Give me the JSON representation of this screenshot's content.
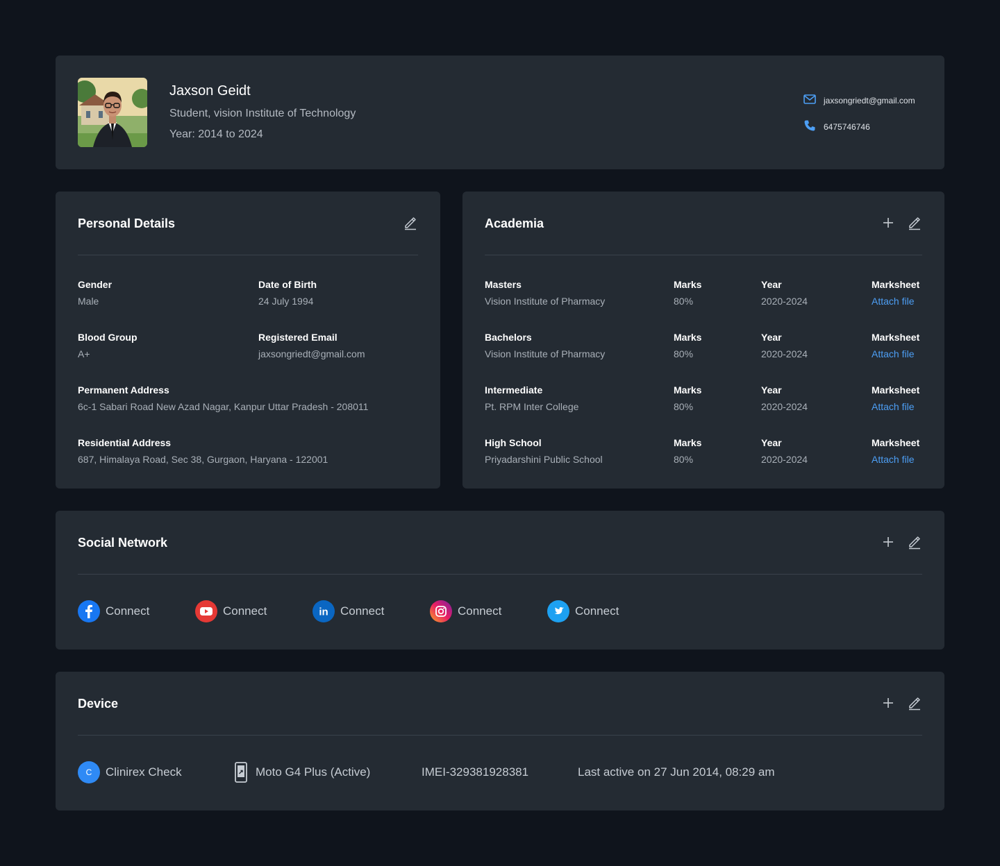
{
  "profile": {
    "name": "Jaxson Geidt",
    "subtitle": "Student, vision Institute of Technology",
    "year": "Year: 2014 to 2024",
    "email": "jaxsongriedt@gmail.com",
    "phone": "6475746746"
  },
  "personal": {
    "title": "Personal Details",
    "fields": [
      {
        "label": "Gender",
        "value": "Male"
      },
      {
        "label": "Date of Birth",
        "value": "24 July 1994"
      },
      {
        "label": "Blood Group",
        "value": "A+"
      },
      {
        "label": "Registered Email",
        "value": "jaxsongriedt@gmail.com"
      },
      {
        "label": "Permanent Address",
        "value": "6c-1 Sabari Road New Azad Nagar, Kanpur Uttar Pradesh - 208011"
      },
      {
        "label": "Residential Address",
        "value": "687, Himalaya Road, Sec 38, Gurgaon, Haryana - 122001"
      }
    ]
  },
  "academia": {
    "title": "Academia",
    "rows": [
      {
        "level": "Masters",
        "school": "Vision Institute of Pharmacy",
        "marks_label": "Marks",
        "marks": "80%",
        "year_label": "Year",
        "year": "2020-2024",
        "sheet_label": "Marksheet",
        "sheet_link": "Attach file"
      },
      {
        "level": "Bachelors",
        "school": "Vision Institute of Pharmacy",
        "marks_label": "Marks",
        "marks": "80%",
        "year_label": "Year",
        "year": "2020-2024",
        "sheet_label": "Marksheet",
        "sheet_link": "Attach file"
      },
      {
        "level": "Intermediate",
        "school": "Pt. RPM Inter College",
        "marks_label": "Marks",
        "marks": "80%",
        "year_label": "Year",
        "year": "2020-2024",
        "sheet_label": "Marksheet",
        "sheet_link": "Attach file"
      },
      {
        "level": "High School",
        "school": "Priyadarshini Public School",
        "marks_label": "Marks",
        "marks": "80%",
        "year_label": "Year",
        "year": "2020-2024",
        "sheet_label": "Marksheet",
        "sheet_link": "Attach file"
      }
    ]
  },
  "social": {
    "title": "Social Network",
    "items": [
      {
        "icon": "facebook-icon",
        "label": "Connect",
        "color": "#1877f2"
      },
      {
        "icon": "youtube-icon",
        "label": "Connect",
        "color": "#e53935"
      },
      {
        "icon": "linkedin-icon",
        "label": "Connect",
        "color": "#0a66c2"
      },
      {
        "icon": "instagram-icon",
        "label": "Connect",
        "color": "#d6249f"
      },
      {
        "icon": "twitter-icon",
        "label": "Connect",
        "color": "#1da1f2"
      }
    ]
  },
  "device": {
    "title": "Device",
    "app_initial": "C",
    "app_name": "Clinirex Check",
    "phone_model": "Moto G4 Plus (Active)",
    "imei": "IMEI-329381928381",
    "last_active": "Last active on 27 Jun 2014, 08:29 am"
  },
  "colors": {
    "background": "#0f141c",
    "card": "#242b33",
    "accent": "#4d9ff5"
  }
}
